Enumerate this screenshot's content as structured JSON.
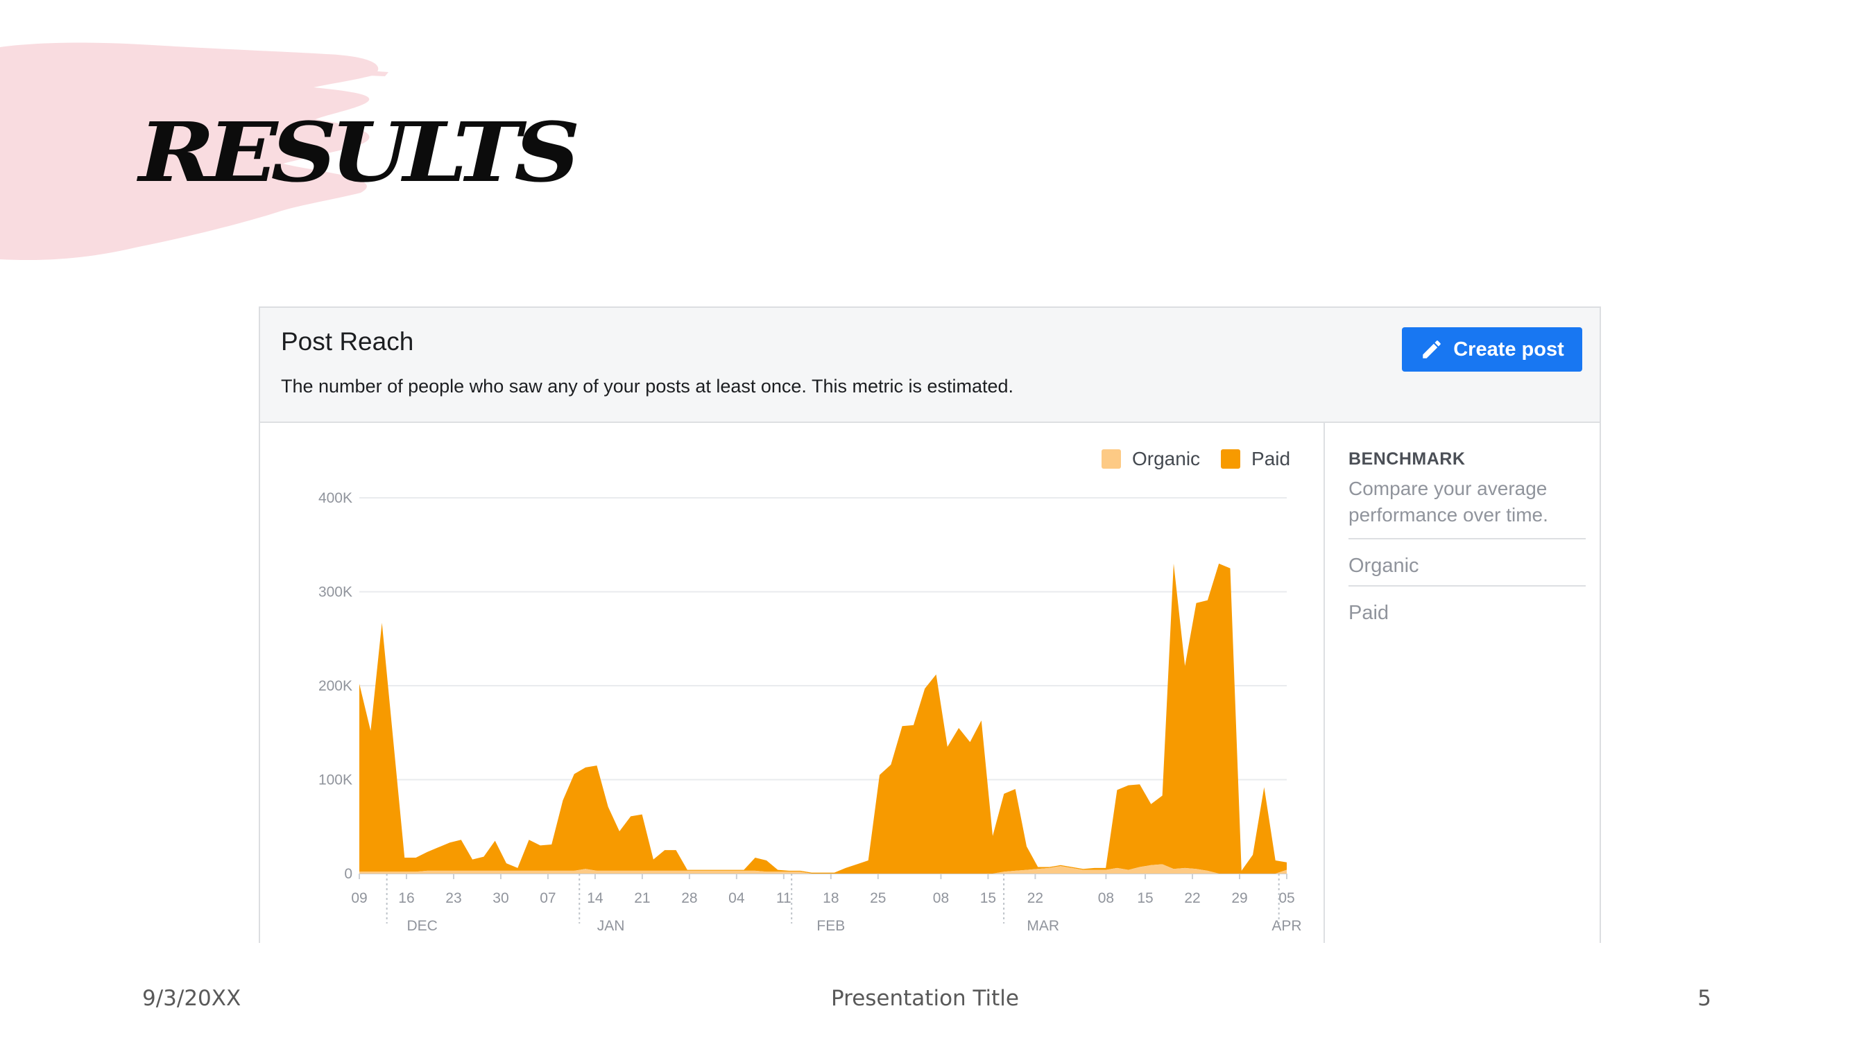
{
  "slide": {
    "title": "RESULTS",
    "footer_date": "9/3/20XX",
    "footer_title": "Presentation Title",
    "page_number": "5"
  },
  "card": {
    "title": "Post Reach",
    "subtitle": "The number of people who saw any of your posts at least once. This metric is estimated.",
    "create_button_label": "Create post"
  },
  "benchmark": {
    "title": "BENCHMARK",
    "description": "Compare your average performance over time.",
    "options": [
      "Organic",
      "Paid"
    ]
  },
  "colors": {
    "brand_blue": "#1877f2",
    "paid": "#f79a00",
    "organic": "#fdca85",
    "brush_pink": "#f9dce0"
  },
  "icons": {
    "create_button": "pencil-icon"
  },
  "chart_data": {
    "type": "area",
    "stacked": true,
    "title": "",
    "xlabel": "",
    "ylabel": "",
    "ylim": [
      0,
      400000
    ],
    "y_ticks": [
      0,
      100000,
      200000,
      300000,
      400000
    ],
    "y_tick_labels": [
      "0",
      "100K",
      "200K",
      "300K",
      "400K"
    ],
    "x_tick_labels": [
      "09",
      "16",
      "23",
      "30",
      "07",
      "14",
      "21",
      "28",
      "04",
      "11",
      "18",
      "25",
      "08",
      "15",
      "22",
      "08",
      "15",
      "22",
      "29",
      "05"
    ],
    "month_labels": [
      "DEC",
      "JAN",
      "FEB",
      "MAR",
      "APR"
    ],
    "legend": [
      "Organic",
      "Paid"
    ],
    "legend_position": "top-right",
    "grid": true,
    "series": [
      {
        "name": "Organic",
        "color": "#fdca85",
        "values": [
          2000,
          2000,
          2000,
          2000,
          2000,
          2000,
          3000,
          3000,
          3000,
          3000,
          3000,
          3000,
          3000,
          3000,
          3000,
          3000,
          3000,
          3000,
          3000,
          3000,
          5000,
          3000,
          3000,
          3000,
          3000,
          3000,
          3000,
          3000,
          3000,
          3000,
          3000,
          3000,
          3000,
          3000,
          3000,
          3000,
          2000,
          2000,
          2000,
          2000,
          0,
          0,
          0,
          0,
          0,
          0,
          0,
          0,
          0,
          0,
          0,
          0,
          0,
          0,
          0,
          0,
          0,
          2000,
          3000,
          4000,
          5000,
          6000,
          8000,
          6000,
          4000,
          4000,
          4000,
          6000,
          4000,
          7000,
          9000,
          10000,
          5000,
          6000,
          5000,
          3000,
          0,
          0,
          0,
          0,
          0,
          0,
          4000,
          5000,
          5000,
          4000,
          3000,
          4000,
          5000,
          4000,
          4000,
          3000,
          3000,
          3000,
          3000,
          4000,
          2000,
          3000,
          3000,
          2000,
          1000
        ]
      },
      {
        "name": "Paid",
        "color": "#f79a00",
        "values": [
          200000,
          150000,
          265000,
          140000,
          15000,
          15000,
          20000,
          25000,
          30000,
          33000,
          12000,
          15000,
          32000,
          8000,
          3000,
          33000,
          27000,
          28000,
          75000,
          103000,
          108000,
          112000,
          68000,
          42000,
          58000,
          60000,
          12000,
          22000,
          22000,
          1000,
          1000,
          1000,
          1000,
          1000,
          1000,
          14000,
          12000,
          2000,
          1000,
          1000,
          1000,
          1000,
          1000,
          6000,
          10000,
          14000,
          105000,
          116000,
          157000,
          158000,
          197000,
          212000,
          135000,
          155000,
          140000,
          163000,
          40000,
          83000,
          87000,
          25000,
          2000,
          1000,
          1000,
          1000,
          1000,
          2000,
          2000,
          83000,
          90000,
          88000,
          65000,
          73000,
          325000,
          215000,
          283000,
          288000,
          330000,
          325000,
          3000,
          20000,
          92000,
          14000,
          8000
        ]
      }
    ]
  }
}
